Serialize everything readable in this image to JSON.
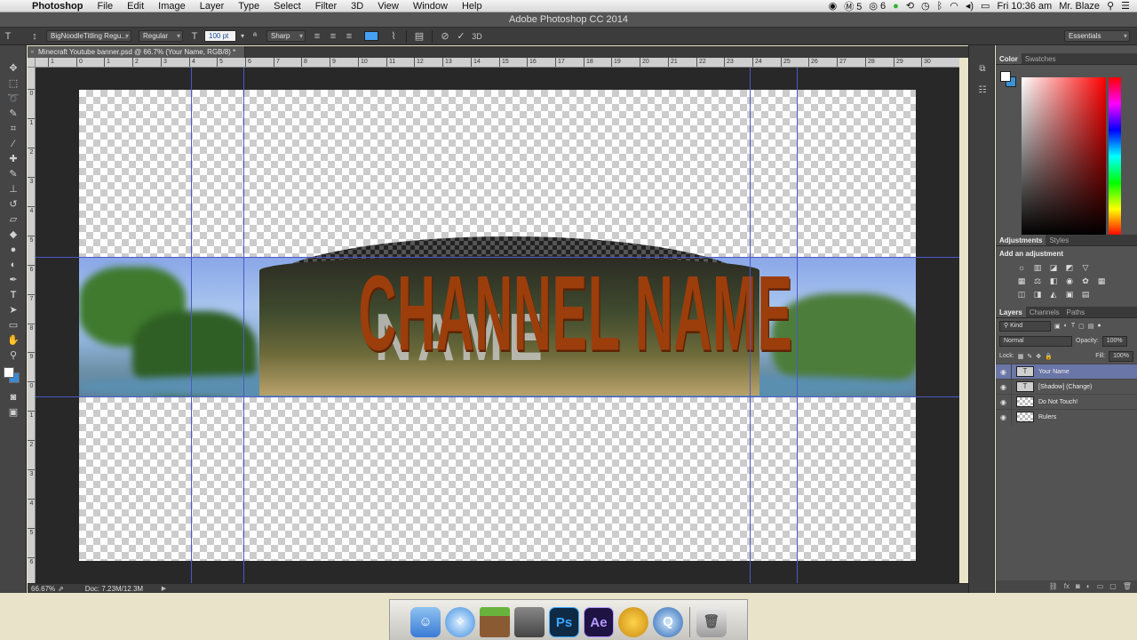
{
  "menubar": {
    "app_name": "Photoshop",
    "items": [
      "File",
      "Edit",
      "Image",
      "Layer",
      "Type",
      "Select",
      "Filter",
      "3D",
      "View",
      "Window",
      "Help"
    ],
    "status": {
      "badge1": "5",
      "badge2": "6",
      "clock": "Fri 10:36 am",
      "user": "Mr. Blaze"
    }
  },
  "window": {
    "title": "Adobe Photoshop CC 2014"
  },
  "options_bar": {
    "font_family": "BigNoodleTitling Regu...",
    "font_style": "Regular",
    "font_size": "100 pt",
    "anti_alias": "Sharp",
    "text_color": "#44a1f2",
    "workspace": "Essentials"
  },
  "document": {
    "tab_title": "Minecraft Youtube banner.psd @ 66.7% (Your Name, RGB/8) *",
    "headline": "CHANNEL NAME",
    "headline_color": "#9b3e0c"
  },
  "rulers": {
    "horizontal": [
      "1",
      "0",
      "1",
      "2",
      "3",
      "4",
      "5",
      "6",
      "7",
      "8",
      "9",
      "10",
      "11",
      "12",
      "13",
      "14",
      "15",
      "16",
      "17",
      "18",
      "19",
      "20",
      "21",
      "22",
      "23",
      "24",
      "25",
      "26",
      "27",
      "28",
      "29",
      "30"
    ],
    "vertical": [
      "0",
      "1",
      "2",
      "3",
      "4",
      "5",
      "6",
      "7",
      "8",
      "9",
      "0",
      "1",
      "2",
      "3",
      "4",
      "5",
      "6"
    ]
  },
  "status_bar": {
    "zoom": "66.67%",
    "doc_size": "Doc: 7.23M/12.3M"
  },
  "panels": {
    "color_tabs": [
      "Color",
      "Swatches"
    ],
    "adjust_tabs": [
      "Adjustments",
      "Styles"
    ],
    "adjust_title": "Add an adjustment",
    "layers_tabs": [
      "Layers",
      "Channels",
      "Paths"
    ],
    "kind_filter": "Kind",
    "blend_mode": "Normal",
    "opacity_label": "Opacity:",
    "opacity_value": "100%",
    "lock_label": "Lock:",
    "fill_label": "Fill:",
    "fill_value": "100%",
    "layers": [
      {
        "name": "Your Name",
        "selected": true
      },
      {
        "name": "[Shadow] (Change)",
        "selected": false
      },
      {
        "name": "Do Not Touch!",
        "selected": false
      },
      {
        "name": "Rulers",
        "selected": false
      }
    ]
  },
  "dock": {
    "apps": [
      "finder-icon",
      "safari-icon",
      "minecraft-icon",
      "terminal-icon",
      "photoshop-icon",
      "after-effects-icon",
      "pineapple-icon",
      "quicktime-icon",
      "trash-icon"
    ],
    "ps_label": "Ps",
    "ae_label": "Ae"
  }
}
